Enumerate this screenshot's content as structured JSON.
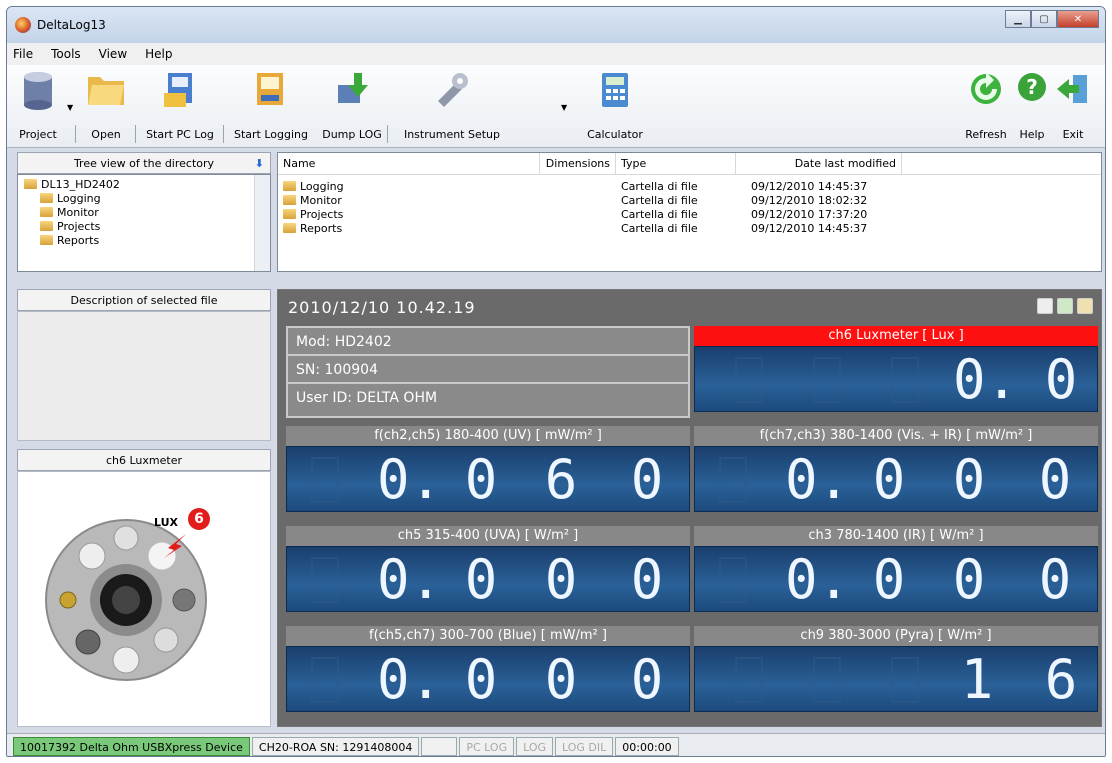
{
  "window": {
    "title": "DeltaLog13"
  },
  "menu": [
    "File",
    "Tools",
    "View",
    "Help"
  ],
  "toolbar": {
    "project": "Project",
    "open": "Open",
    "start_pc_log": "Start PC Log",
    "start_logging": "Start Logging",
    "dump_log": "Dump LOG",
    "instrument_setup": "Instrument Setup",
    "calculator": "Calculator",
    "refresh": "Refresh",
    "help": "Help",
    "exit": "Exit"
  },
  "tree": {
    "header": "Tree view of the directory",
    "root": "DL13_HD2402",
    "children": [
      "Logging",
      "Monitor",
      "Projects",
      "Reports"
    ]
  },
  "filelist": {
    "columns": [
      "Name",
      "Dimensions",
      "Type",
      "Date last modified"
    ],
    "rows": [
      {
        "name": "Logging",
        "type": "Cartella di file",
        "date": "09/12/2010 14:45:37"
      },
      {
        "name": "Monitor",
        "type": "Cartella di file",
        "date": "09/12/2010 18:02:32"
      },
      {
        "name": "Projects",
        "type": "Cartella di file",
        "date": "09/12/2010 17:37:20"
      },
      {
        "name": "Reports",
        "type": "Cartella di file",
        "date": "09/12/2010 14:45:37"
      }
    ]
  },
  "description": {
    "header": "Description of selected file"
  },
  "probe": {
    "header": "ch6 Luxmeter",
    "label": "LUX",
    "number": "6"
  },
  "monitor": {
    "datetime": "2010/12/10 10.42.19",
    "mod": "Mod: HD2402",
    "sn": "SN: 100904",
    "user": "User ID: DELTA OHM",
    "meters": [
      {
        "label": "ch6 Luxmeter [ Lux ]",
        "digits": [
          "0.",
          "0"
        ]
      },
      {
        "label": "f(ch2,ch5) 180-400 (UV) [  mW/m² ]",
        "digits": [
          "0.",
          "0",
          "6",
          "0"
        ]
      },
      {
        "label": "f(ch7,ch3) 380-1400 (Vis. + IR) [  mW/m² ]",
        "digits": [
          "0.",
          "0",
          "0",
          "0"
        ]
      },
      {
        "label": "ch5 315-400 (UVA) [  W/m² ]",
        "digits": [
          "0.",
          "0",
          "0",
          "0"
        ]
      },
      {
        "label": "ch3 780-1400 (IR) [  W/m² ]",
        "digits": [
          "0.",
          "0",
          "0",
          "0"
        ]
      },
      {
        "label": "f(ch5,ch7) 300-700 (Blue) [  mW/m² ]",
        "digits": [
          "0.",
          "0",
          "0",
          "0"
        ]
      },
      {
        "label": "ch9 380-3000 (Pyra) [  W/m² ]",
        "digits": [
          "1",
          "6"
        ]
      }
    ]
  },
  "status": {
    "device": "10017392  Delta Ohm USBXpress Device",
    "probe_sn": "CH20-ROA SN: 1291408004",
    "pc_log": "PC LOG",
    "log": "LOG",
    "log_dil": "LOG DIL",
    "timer": "00:00:00"
  }
}
